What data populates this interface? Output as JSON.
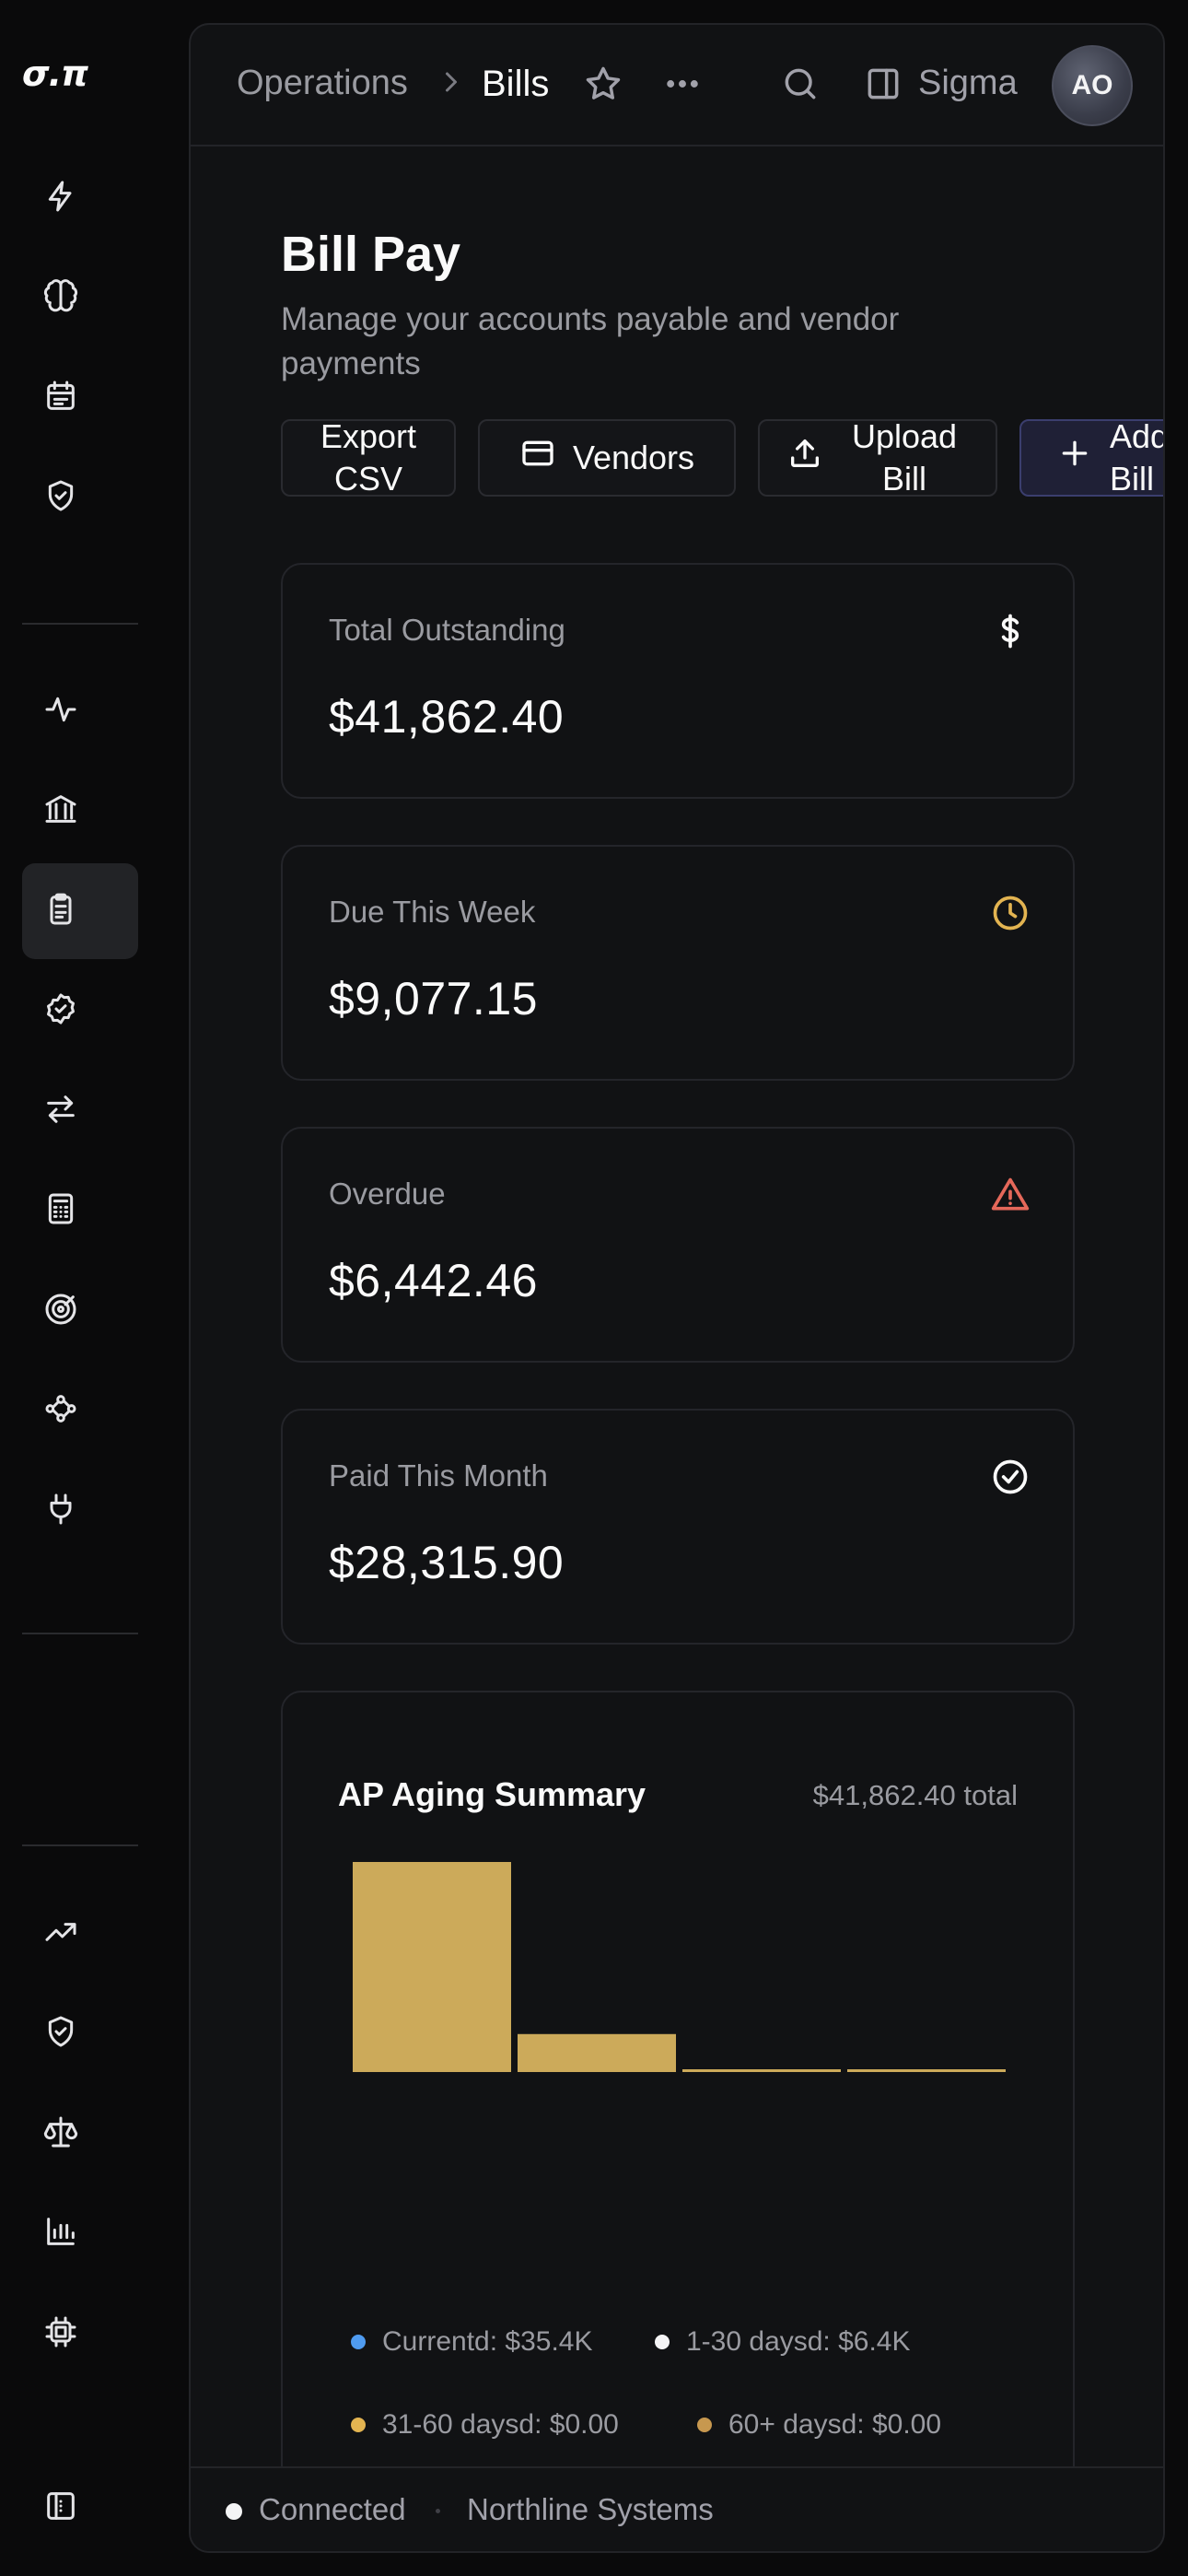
{
  "app": {
    "logo": "σ.π"
  },
  "rail": {
    "groups": [
      {
        "items": [
          {
            "icon": "lightning-icon"
          },
          {
            "icon": "brain-icon"
          },
          {
            "icon": "calendar-icon"
          },
          {
            "icon": "shield-check-icon"
          }
        ]
      },
      {
        "items": [
          {
            "icon": "activity-icon"
          },
          {
            "icon": "bank-icon"
          },
          {
            "icon": "clipboard-icon",
            "active": true
          },
          {
            "icon": "badge-check-icon"
          },
          {
            "icon": "arrows-swap-icon"
          },
          {
            "icon": "calculator-icon"
          },
          {
            "icon": "target-icon"
          },
          {
            "icon": "workflow-icon"
          },
          {
            "icon": "plug-icon"
          }
        ]
      },
      {
        "items": [
          {
            "icon": "trending-up-icon"
          },
          {
            "icon": "shield-check-icon"
          },
          {
            "icon": "scale-icon"
          },
          {
            "icon": "bar-chart-icon"
          },
          {
            "icon": "cpu-icon"
          }
        ]
      }
    ],
    "bottom_icon": "sidebar-toggle-icon"
  },
  "topbar": {
    "breadcrumb_parent": "Operations",
    "breadcrumb_current": "Bills",
    "workspace": "Sigma",
    "avatar_initials": "AO"
  },
  "page": {
    "title": "Bill Pay",
    "subtitle": "Manage your accounts payable and vendor payments"
  },
  "actions": {
    "export_label": "Export CSV",
    "vendors_label": "Vendors",
    "upload_label": "Upload Bill",
    "add_label": "Add Bill"
  },
  "stats": [
    {
      "label": "Total Outstanding",
      "value": "$41,862.40",
      "icon": "dollar-icon",
      "color": "#fafafa"
    },
    {
      "label": "Due This Week",
      "value": "$9,077.15",
      "icon": "clock-icon",
      "color": "#e3b451"
    },
    {
      "label": "Overdue",
      "value": "$6,442.46",
      "icon": "alert-triangle-icon",
      "color": "#e5685a"
    },
    {
      "label": "Paid This Month",
      "value": "$28,315.90",
      "icon": "check-circle-icon",
      "color": "#fafafa"
    }
  ],
  "chart": {
    "title": "AP Aging Summary",
    "total_label": "$41,862.40 total"
  },
  "chart_data": {
    "type": "bar",
    "categories": [
      "Current",
      "1-30 days",
      "31-60 days",
      "60+ days"
    ],
    "values": [
      35.4,
      6.4,
      0,
      0
    ],
    "unit": "$K",
    "bar_color": "#ccaa5a",
    "legend": [
      {
        "label": "Currentd: $35.4K",
        "color": "#4f9bf0"
      },
      {
        "label": "1-30 daysd: $6.4K",
        "color": "#f4f4f5"
      },
      {
        "label": "31-60 daysd: $0.00",
        "color": "#e3b451"
      },
      {
        "label": "60+ daysd: $0.00",
        "color": "#c7984f"
      }
    ]
  },
  "status": {
    "connection": "Connected",
    "organization": "Northline Systems"
  }
}
